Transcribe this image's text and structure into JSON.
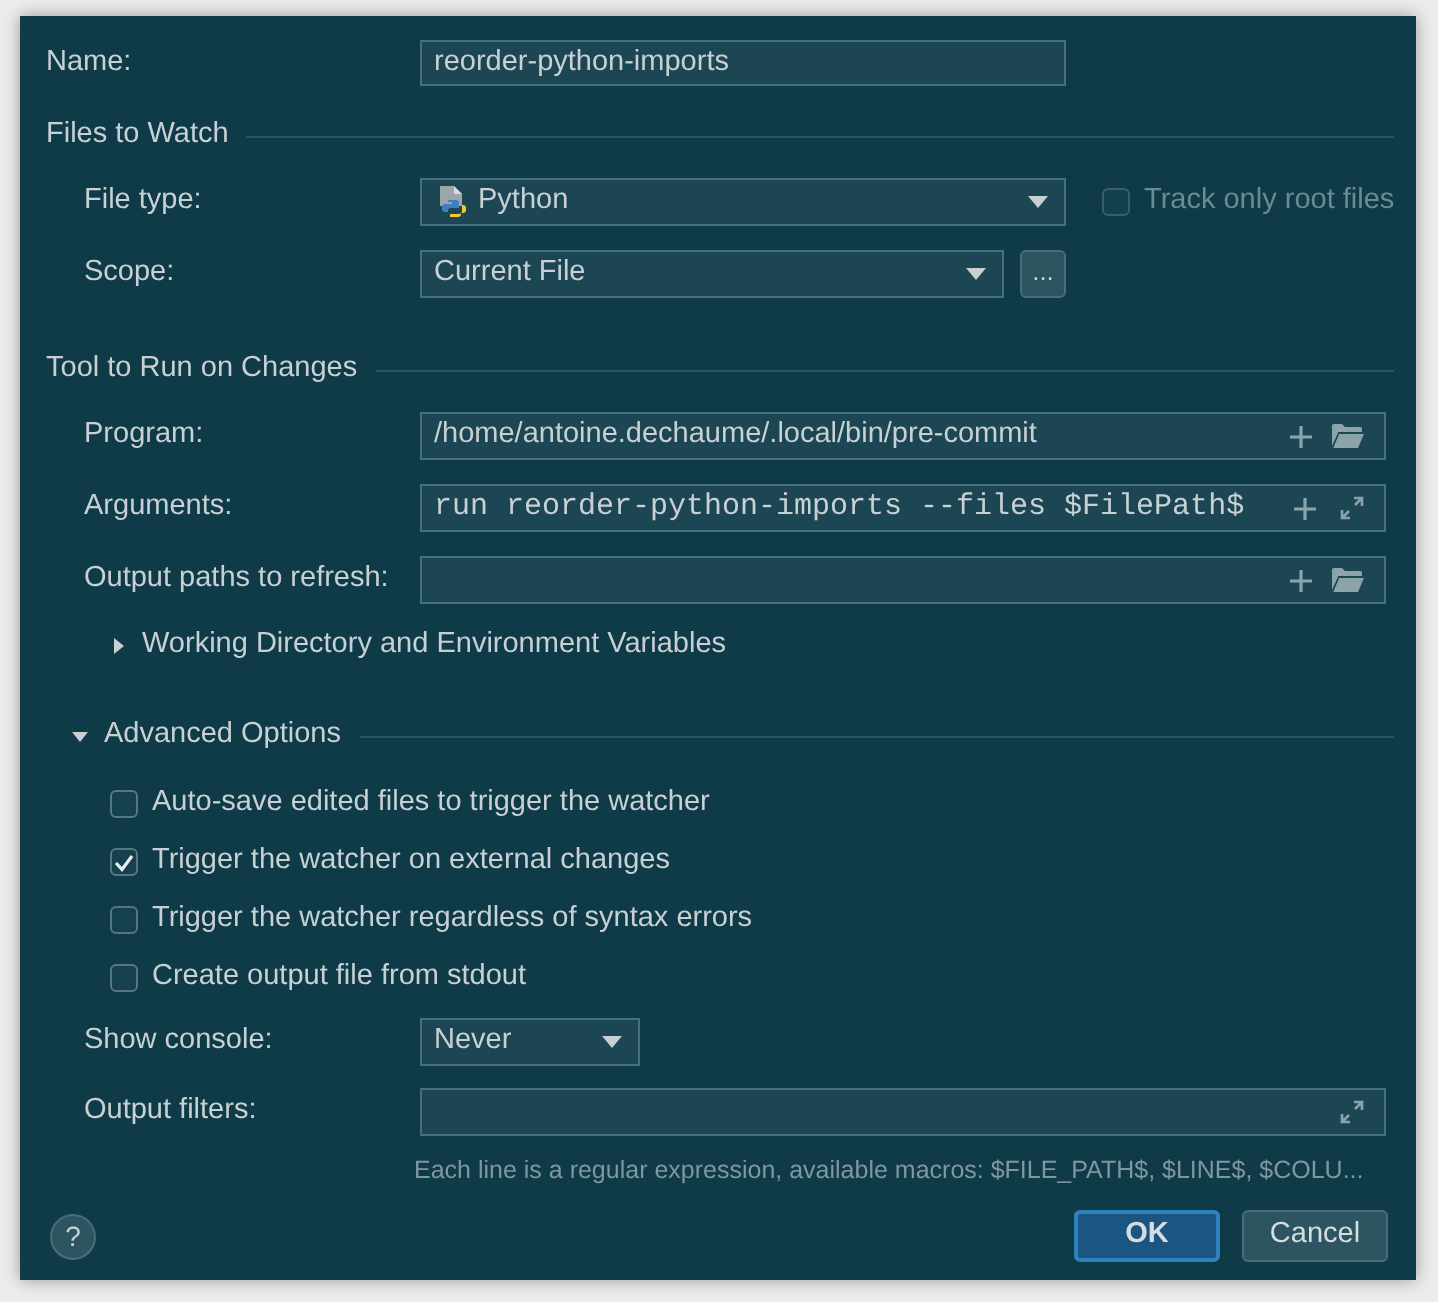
{
  "name_field": {
    "label": "Name:",
    "value": "reorder-python-imports"
  },
  "files_to_watch": {
    "title": "Files to Watch",
    "file_type": {
      "label": "File type:",
      "value": "Python"
    },
    "track_only_root_files": {
      "label": "Track only root files",
      "checked": false,
      "disabled": true
    },
    "scope": {
      "label": "Scope:",
      "value": "Current File",
      "browse_label": "..."
    }
  },
  "tool_to_run": {
    "title": "Tool to Run on Changes",
    "fields": [
      {
        "kind": "path",
        "label": "Program:",
        "value": "/home/antoine.dechaume/.local/bin/pre-commit"
      },
      {
        "kind": "arguments",
        "label": "Arguments:",
        "value": "run reorder-python-imports --files $FilePath$"
      },
      {
        "kind": "path",
        "label": "Output paths to refresh:"
      }
    ],
    "working_directory": {
      "label": "Working Directory and Environment Variables",
      "expanded": false
    }
  },
  "advanced_options": {
    "title": "Advanced Options",
    "expanded": true,
    "options": [
      {
        "label": "Auto-save edited files to trigger the watcher",
        "checked": false
      },
      {
        "label": "Trigger the watcher on external changes",
        "checked": true
      },
      {
        "label": "Trigger the watcher regardless of syntax errors",
        "checked": false
      },
      {
        "label": "Create output file from stdout",
        "checked": false
      }
    ],
    "show_console": {
      "label": "Show console:",
      "value": "Never"
    },
    "output_filters": {
      "label": "Output filters:",
      "hint": "Each line is a regular expression, available macros: $FILE_PATH$, $LINE$, $COLU..."
    }
  },
  "help": "?",
  "buttons": [
    {
      "label": "OK",
      "default": true
    },
    {
      "label": "Cancel",
      "default": false
    }
  ]
}
